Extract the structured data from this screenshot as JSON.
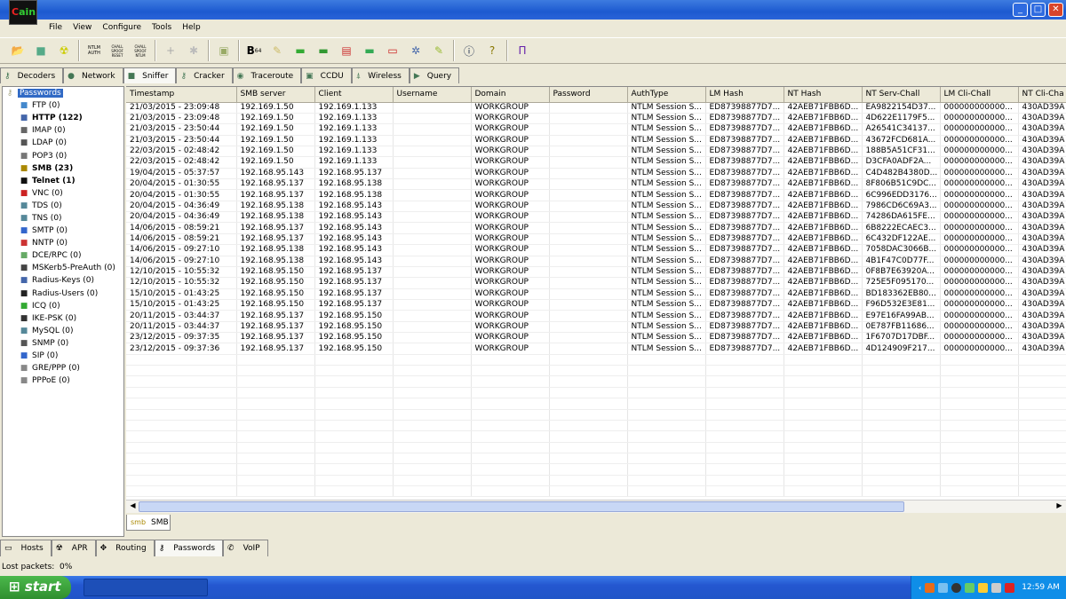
{
  "app": {
    "logo_text": "Cain"
  },
  "menu": [
    "File",
    "View",
    "Configure",
    "Tools",
    "Help"
  ],
  "toolbar_icons": [
    "open-icon",
    "sniffer-icon",
    "apr-icon",
    "ntlm-auth-icon",
    "chall-spoof-reset-icon",
    "chall-spoof-ntlm-icon",
    "add-icon",
    "remove-icon",
    "certificate-icon",
    "base64-icon",
    "key-icon",
    "rsa-icon",
    "hash-icon",
    "vnc-icon",
    "cisco-icon",
    "box-icon",
    "network-icon",
    "edit-icon",
    "info-icon",
    "help-icon",
    "exit-icon"
  ],
  "toolbar_text": {
    "b64": "B",
    "b64_sub": "64",
    "ntlm": "NTLM AUTH",
    "chall1": "CHALL SPOOF RESET",
    "chall2": "CHALL SPOOF NTLM"
  },
  "tabs": [
    "Decoders",
    "Network",
    "Sniffer",
    "Cracker",
    "Traceroute",
    "CCDU",
    "Wireless",
    "Query"
  ],
  "active_tab": "Sniffer",
  "tree": {
    "root": "Passwords",
    "items": [
      {
        "label": "FTP (0)",
        "bold": false
      },
      {
        "label": "HTTP (122)",
        "bold": true
      },
      {
        "label": "IMAP (0)",
        "bold": false
      },
      {
        "label": "LDAP (0)",
        "bold": false
      },
      {
        "label": "POP3 (0)",
        "bold": false
      },
      {
        "label": "SMB (23)",
        "bold": true
      },
      {
        "label": "Telnet (1)",
        "bold": true
      },
      {
        "label": "VNC (0)",
        "bold": false
      },
      {
        "label": "TDS (0)",
        "bold": false
      },
      {
        "label": "TNS (0)",
        "bold": false
      },
      {
        "label": "SMTP (0)",
        "bold": false
      },
      {
        "label": "NNTP (0)",
        "bold": false
      },
      {
        "label": "DCE/RPC (0)",
        "bold": false
      },
      {
        "label": "MSKerb5-PreAuth (0)",
        "bold": false
      },
      {
        "label": "Radius-Keys (0)",
        "bold": false
      },
      {
        "label": "Radius-Users (0)",
        "bold": false
      },
      {
        "label": "ICQ (0)",
        "bold": false
      },
      {
        "label": "IKE-PSK (0)",
        "bold": false
      },
      {
        "label": "MySQL (0)",
        "bold": false
      },
      {
        "label": "SNMP (0)",
        "bold": false
      },
      {
        "label": "SIP (0)",
        "bold": false
      },
      {
        "label": "GRE/PPP (0)",
        "bold": false
      },
      {
        "label": "PPPoE (0)",
        "bold": false
      }
    ]
  },
  "table": {
    "columns": [
      "Timestamp",
      "SMB server",
      "Client",
      "Username",
      "Domain",
      "Password",
      "AuthType",
      "LM Hash",
      "NT Hash",
      "NT Serv-Chall",
      "LM Cli-Chall",
      "NT Cli-Cha"
    ],
    "rows": [
      [
        "21/03/2015 - 23:09:48",
        "192.169.1.50",
        "192.169.1.133",
        "",
        "WORKGROUP",
        "",
        "NTLM Session S...",
        "ED87398877D7...",
        "42AEB71FBB6D...",
        "EA9822154D37...",
        "000000000000...",
        "430AD39A"
      ],
      [
        "21/03/2015 - 23:09:48",
        "192.169.1.50",
        "192.169.1.133",
        "",
        "WORKGROUP",
        "",
        "NTLM Session S...",
        "ED87398877D7...",
        "42AEB71FBB6D...",
        "4D622E1179F5...",
        "000000000000...",
        "430AD39A"
      ],
      [
        "21/03/2015 - 23:50:44",
        "192.169.1.50",
        "192.169.1.133",
        "",
        "WORKGROUP",
        "",
        "NTLM Session S...",
        "ED87398877D7...",
        "42AEB71FBB6D...",
        "A26541C34137...",
        "000000000000...",
        "430AD39A"
      ],
      [
        "21/03/2015 - 23:50:44",
        "192.169.1.50",
        "192.169.1.133",
        "",
        "WORKGROUP",
        "",
        "NTLM Session S...",
        "ED87398877D7...",
        "42AEB71FBB6D...",
        "43672FCD681A...",
        "000000000000...",
        "430AD39A"
      ],
      [
        "22/03/2015 - 02:48:42",
        "192.169.1.50",
        "192.169.1.133",
        "",
        "WORKGROUP",
        "",
        "NTLM Session S...",
        "ED87398877D7...",
        "42AEB71FBB6D...",
        "188B5A51CF31...",
        "000000000000...",
        "430AD39A"
      ],
      [
        "22/03/2015 - 02:48:42",
        "192.169.1.50",
        "192.169.1.133",
        "",
        "WORKGROUP",
        "",
        "NTLM Session S...",
        "ED87398877D7...",
        "42AEB71FBB6D...",
        "D3CFA0ADF2A...",
        "000000000000...",
        "430AD39A"
      ],
      [
        "19/04/2015 - 05:37:57",
        "192.168.95.143",
        "192.168.95.137",
        "",
        "WORKGROUP",
        "",
        "NTLM Session S...",
        "ED87398877D7...",
        "42AEB71FBB6D...",
        "C4D482B4380D...",
        "000000000000...",
        "430AD39A"
      ],
      [
        "20/04/2015 - 01:30:55",
        "192.168.95.137",
        "192.168.95.138",
        "",
        "WORKGROUP",
        "",
        "NTLM Session S...",
        "ED87398877D7...",
        "42AEB71FBB6D...",
        "8F806B51C9DC...",
        "000000000000...",
        "430AD39A"
      ],
      [
        "20/04/2015 - 01:30:55",
        "192.168.95.137",
        "192.168.95.138",
        "",
        "WORKGROUP",
        "",
        "NTLM Session S...",
        "ED87398877D7...",
        "42AEB71FBB6D...",
        "6C996EDD3176...",
        "000000000000...",
        "430AD39A"
      ],
      [
        "20/04/2015 - 04:36:49",
        "192.168.95.138",
        "192.168.95.143",
        "",
        "WORKGROUP",
        "",
        "NTLM Session S...",
        "ED87398877D7...",
        "42AEB71FBB6D...",
        "7986CD6C69A3...",
        "000000000000...",
        "430AD39A"
      ],
      [
        "20/04/2015 - 04:36:49",
        "192.168.95.138",
        "192.168.95.143",
        "",
        "WORKGROUP",
        "",
        "NTLM Session S...",
        "ED87398877D7...",
        "42AEB71FBB6D...",
        "74286DA615FE...",
        "000000000000...",
        "430AD39A"
      ],
      [
        "14/06/2015 - 08:59:21",
        "192.168.95.137",
        "192.168.95.143",
        "",
        "WORKGROUP",
        "",
        "NTLM Session S...",
        "ED87398877D7...",
        "42AEB71FBB6D...",
        "6B8222ECAEC3...",
        "000000000000...",
        "430AD39A"
      ],
      [
        "14/06/2015 - 08:59:21",
        "192.168.95.137",
        "192.168.95.143",
        "",
        "WORKGROUP",
        "",
        "NTLM Session S...",
        "ED87398877D7...",
        "42AEB71FBB6D...",
        "6C432DF122AE...",
        "000000000000...",
        "430AD39A"
      ],
      [
        "14/06/2015 - 09:27:10",
        "192.168.95.138",
        "192.168.95.143",
        "",
        "WORKGROUP",
        "",
        "NTLM Session S...",
        "ED87398877D7...",
        "42AEB71FBB6D...",
        "7058DAC3066B...",
        "000000000000...",
        "430AD39A"
      ],
      [
        "14/06/2015 - 09:27:10",
        "192.168.95.138",
        "192.168.95.143",
        "",
        "WORKGROUP",
        "",
        "NTLM Session S...",
        "ED87398877D7...",
        "42AEB71FBB6D...",
        "4B1F47C0D77F...",
        "000000000000...",
        "430AD39A"
      ],
      [
        "12/10/2015 - 10:55:32",
        "192.168.95.150",
        "192.168.95.137",
        "",
        "WORKGROUP",
        "",
        "NTLM Session S...",
        "ED87398877D7...",
        "42AEB71FBB6D...",
        "0F8B7E63920A...",
        "000000000000...",
        "430AD39A"
      ],
      [
        "12/10/2015 - 10:55:32",
        "192.168.95.150",
        "192.168.95.137",
        "",
        "WORKGROUP",
        "",
        "NTLM Session S...",
        "ED87398877D7...",
        "42AEB71FBB6D...",
        "725E5F095170...",
        "000000000000...",
        "430AD39A"
      ],
      [
        "15/10/2015 - 01:43:25",
        "192.168.95.150",
        "192.168.95.137",
        "",
        "WORKGROUP",
        "",
        "NTLM Session S...",
        "ED87398877D7...",
        "42AEB71FBB6D...",
        "BD183362EB80...",
        "000000000000...",
        "430AD39A"
      ],
      [
        "15/10/2015 - 01:43:25",
        "192.168.95.150",
        "192.168.95.137",
        "",
        "WORKGROUP",
        "",
        "NTLM Session S...",
        "ED87398877D7...",
        "42AEB71FBB6D...",
        "F96D532E3E81...",
        "000000000000...",
        "430AD39A"
      ],
      [
        "20/11/2015 - 03:44:37",
        "192.168.95.137",
        "192.168.95.150",
        "",
        "WORKGROUP",
        "",
        "NTLM Session S...",
        "ED87398877D7...",
        "42AEB71FBB6D...",
        "E97E16FA99AB...",
        "000000000000...",
        "430AD39A"
      ],
      [
        "20/11/2015 - 03:44:37",
        "192.168.95.137",
        "192.168.95.150",
        "",
        "WORKGROUP",
        "",
        "NTLM Session S...",
        "ED87398877D7...",
        "42AEB71FBB6D...",
        "0E787FB11686...",
        "000000000000...",
        "430AD39A"
      ],
      [
        "23/12/2015 - 09:37:35",
        "192.168.95.137",
        "192.168.95.150",
        "",
        "WORKGROUP",
        "",
        "NTLM Session S...",
        "ED87398877D7...",
        "42AEB71FBB6D...",
        "1F6707D17DBF...",
        "000000000000...",
        "430AD39A"
      ],
      [
        "23/12/2015 - 09:37:36",
        "192.168.95.137",
        "192.168.95.150",
        "",
        "WORKGROUP",
        "",
        "NTLM Session S...",
        "ED87398877D7...",
        "42AEB71FBB6D...",
        "4D124909F217...",
        "000000000000...",
        "430AD39A"
      ]
    ]
  },
  "sub_tab": "SMB",
  "bottom_tabs": [
    "Hosts",
    "APR",
    "Routing",
    "Passwords",
    "VoIP"
  ],
  "active_bottom_tab": "Passwords",
  "status": {
    "label": "Lost packets:",
    "value": "0%"
  },
  "taskbar": {
    "start": "start",
    "clock": "12:59 AM"
  }
}
